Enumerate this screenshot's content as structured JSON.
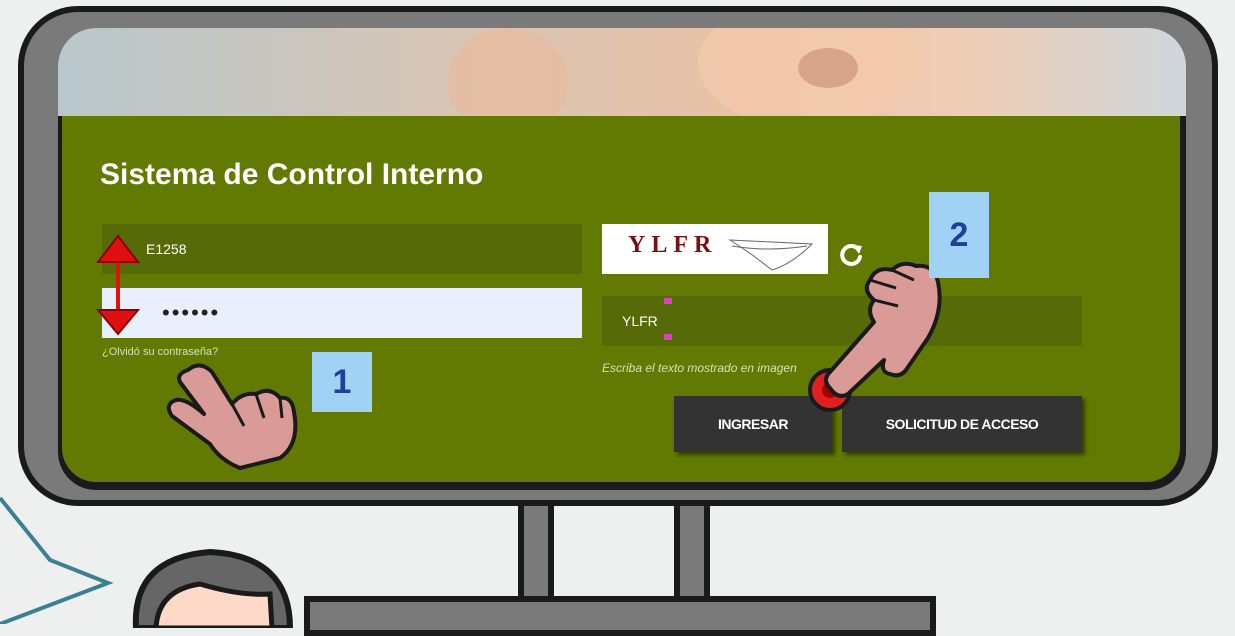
{
  "login": {
    "title": "Sistema de Control Interno",
    "username_value": "E1258",
    "password_mask": "••••••",
    "forgot_link": "¿Olvidó su contraseña?",
    "captcha_code": "YLFR",
    "captcha_input_value": "YLFR",
    "captcha_hint": "Escriba el texto mostrado en imagen",
    "login_button": "INGRESAR",
    "request_button": "SOLICITUD DE ACCESO"
  },
  "annotations": {
    "step1": "1",
    "step2": "2"
  },
  "icons": {
    "refresh": "refresh-icon",
    "pointer_hand": "pointing-hand-icon",
    "resize_arrow": "double-arrow-icon"
  },
  "colors": {
    "panel": "#637a02",
    "field_dark": "#566a08",
    "field_light": "#e9effd",
    "button": "#333333",
    "badge": "#9fd2f4",
    "badge_text": "#1e3f9e",
    "arrow": "#e01010",
    "hand": "#d99a98"
  }
}
